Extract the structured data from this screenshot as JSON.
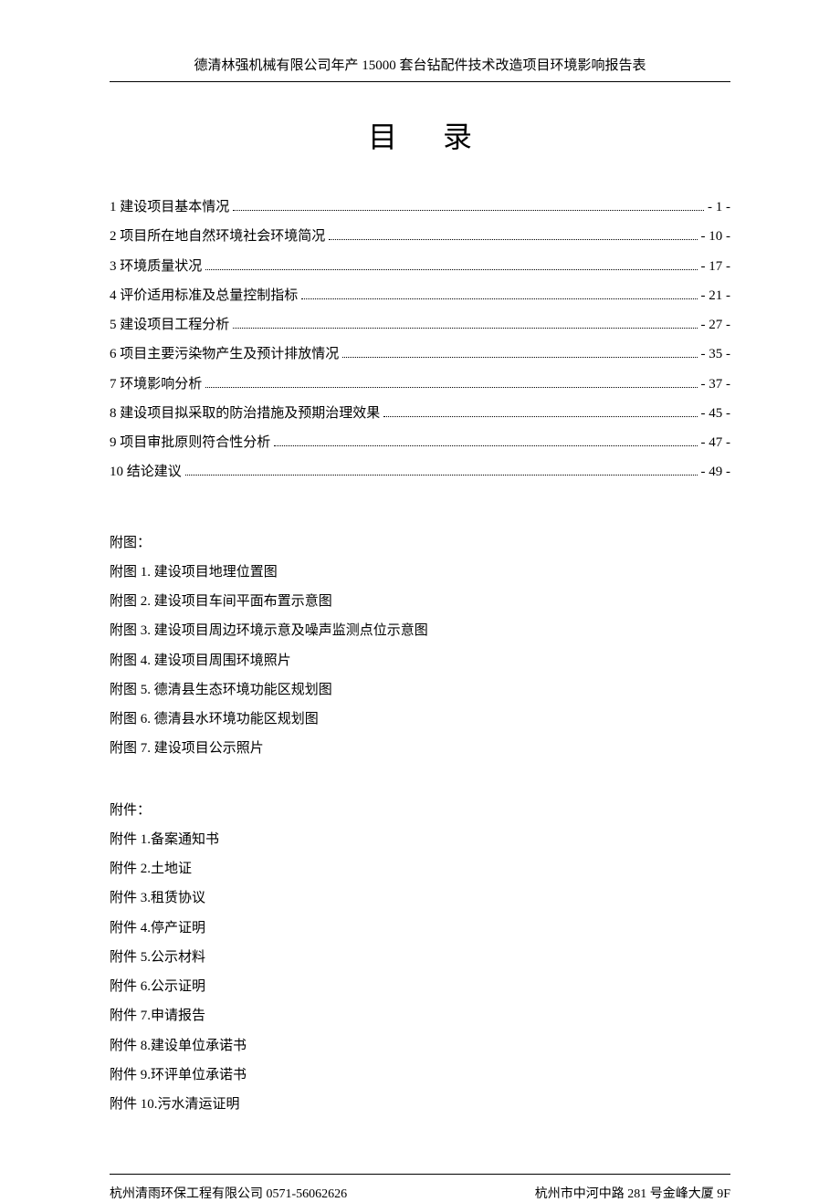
{
  "header": "德清林强机械有限公司年产 15000 套台钻配件技术改造项目环境影响报告表",
  "title": "目录",
  "toc": [
    {
      "label": "1 建设项目基本情况",
      "page": "- 1 -"
    },
    {
      "label": "2 项目所在地自然环境社会环境简况",
      "page": "- 10 -"
    },
    {
      "label": "3 环境质量状况",
      "page": "- 17 -"
    },
    {
      "label": "4 评价适用标准及总量控制指标",
      "page": "- 21 -"
    },
    {
      "label": "5 建设项目工程分析",
      "page": "- 27 -"
    },
    {
      "label": "6 项目主要污染物产生及预计排放情况",
      "page": "- 35 -"
    },
    {
      "label": "7 环境影响分析",
      "page": "- 37 -"
    },
    {
      "label": "8 建设项目拟采取的防治措施及预期治理效果",
      "page": "- 45 -"
    },
    {
      "label": "9 项目审批原则符合性分析",
      "page": "- 47 -"
    },
    {
      "label": "10 结论建议",
      "page": "- 49 -"
    }
  ],
  "figures_label": "附图：",
  "figures": [
    "附图 1.  建设项目地理位置图",
    "附图 2.  建设项目车间平面布置示意图",
    "附图 3.  建设项目周边环境示意及噪声监测点位示意图",
    "附图 4.  建设项目周围环境照片",
    "附图 5.  德清县生态环境功能区规划图",
    "附图 6.  德清县水环境功能区规划图",
    "附图 7.  建设项目公示照片"
  ],
  "attachments_label": "附件：",
  "attachments": [
    "附件 1.备案通知书",
    "附件 2.土地证",
    "附件 3.租赁协议",
    "附件 4.停产证明",
    "附件 5.公示材料",
    "附件 6.公示证明",
    "附件 7.申请报告",
    "附件 8.建设单位承诺书",
    "附件 9.环评单位承诺书",
    "附件 10.污水清运证明"
  ],
  "footer_left": "杭州清雨环保工程有限公司 0571-56062626",
  "footer_right": "杭州市中河中路 281 号金峰大厦 9F"
}
